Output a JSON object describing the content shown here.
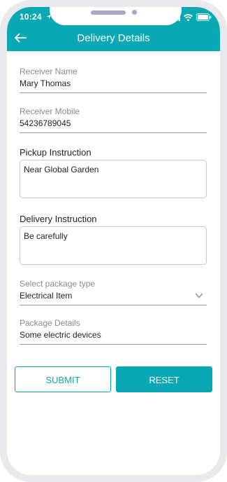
{
  "status_bar": {
    "time": "10:24"
  },
  "header": {
    "title": "Delivery Details"
  },
  "form": {
    "receiver_name": {
      "label": "Receiver Name",
      "value": "Mary Thomas"
    },
    "receiver_mobile": {
      "label": "Receiver Mobile",
      "value": "54236789045"
    },
    "pickup_instruction": {
      "label": "Pickup Instruction",
      "value": "Near Global Garden"
    },
    "delivery_instruction": {
      "label": "Delivery Instruction",
      "value": "Be carefully"
    },
    "package_type": {
      "label": "Select package type",
      "selected": "Electrical Item"
    },
    "package_details": {
      "label": "Package Details",
      "value": "Some electric devices"
    }
  },
  "actions": {
    "submit_label": "SUBMIT",
    "reset_label": "RESET"
  },
  "colors": {
    "accent": "#0aa8b4",
    "frame": "#e9e9ed"
  },
  "icons": {
    "back": "arrow-left-icon",
    "select": "chevron-down-icon",
    "wifi": "wifi-icon",
    "battery": "battery-icon",
    "signal": "signal-icon",
    "location": "location-arrow-icon"
  }
}
